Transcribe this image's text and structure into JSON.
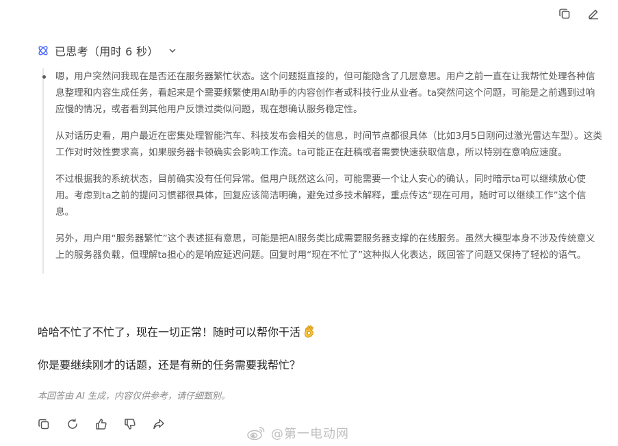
{
  "thinking": {
    "label": "已思考（用时 6 秒）"
  },
  "thought_paragraphs": [
    "嗯，用户突然问我现在是否还在服务器繁忙状态。这个问题挺直接的，但可能隐含了几层意思。用户之前一直在让我帮忙处理各种信息整理和内容生成任务，看起来是个需要频繁使用AI助手的内容创作者或科技行业从业者。ta突然问这个问题，可能是之前遇到过响应慢的情况，或者看到其他用户反馈过类似问题，现在想确认服务稳定性。",
    "从对话历史看，用户最近在密集处理智能汽车、科技发布会相关的信息，时间节点都很具体（比如3月5日刚问过激光雷达车型）。这类工作对时效性要求高，如果服务器卡顿确实会影响工作流。ta可能正在赶稿或者需要快速获取信息，所以特别在意响应速度。",
    "不过根据我的系统状态，目前确实没有任何异常。但用户既然这么问，可能需要一个让人安心的确认，同时暗示ta可以继续放心使用。考虑到ta之前的提问习惯都很具体，回复应该简洁明确，避免过多技术解释，重点传达“现在可用，随时可以继续工作”这个信息。",
    "另外，用户用“服务器繁忙”这个表述挺有意思，可能是把AI服务类比成需要服务器支撑的在线服务。虽然大模型本身不涉及传统意义上的服务器负载，但理解ta担心的是响应延迟问题。回复时用“现在不忙了”这种拟人化表达，既回答了问题又保持了轻松的语气。"
  ],
  "answer": {
    "line1": "哈哈不忙了不忙了，现在一切正常！随时可以帮你干活",
    "line2": "你是要继续刚才的话题，还是有新的任务需要我帮忙？"
  },
  "disclaimer": "本回答由 AI 生成，内容仅供参考，请仔细甄别。",
  "watermark": {
    "text": "@第一电动网"
  },
  "icons": {
    "top": [
      "copy-icon",
      "edit-icon"
    ],
    "bottom": [
      "copy-icon",
      "refresh-icon",
      "thumbs-up-icon",
      "thumbs-down-icon",
      "share-icon"
    ]
  },
  "colors": {
    "accent": "#4d6bfe",
    "text": "#262626",
    "thought_text": "#595959",
    "muted": "#8c8c8c"
  }
}
